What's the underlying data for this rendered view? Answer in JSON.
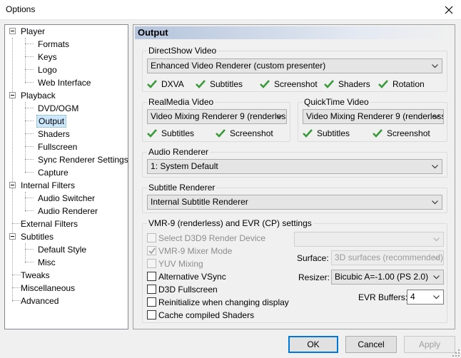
{
  "window": {
    "title": "Options"
  },
  "tree": {
    "player": "Player",
    "formats": "Formats",
    "keys": "Keys",
    "logo": "Logo",
    "web_interface": "Web Interface",
    "playback": "Playback",
    "dvd_ogm": "DVD/OGM",
    "output": "Output",
    "shaders": "Shaders",
    "fullscreen": "Fullscreen",
    "sync_renderer": "Sync Renderer Settings",
    "capture": "Capture",
    "internal_filters": "Internal Filters",
    "audio_switcher": "Audio Switcher",
    "audio_renderer": "Audio Renderer",
    "external_filters": "External Filters",
    "subtitles": "Subtitles",
    "default_style": "Default Style",
    "misc": "Misc",
    "tweaks": "Tweaks",
    "miscellaneous": "Miscellaneous",
    "advanced": "Advanced"
  },
  "page": {
    "heading": "Output"
  },
  "directshow": {
    "label": "DirectShow Video",
    "renderer": "Enhanced Video Renderer (custom presenter)",
    "features": [
      "DXVA",
      "Subtitles",
      "Screenshot",
      "Shaders",
      "Rotation"
    ]
  },
  "realmedia": {
    "label": "RealMedia Video",
    "renderer": "Video Mixing Renderer 9 (renderless",
    "features": [
      "Subtitles",
      "Screenshot"
    ]
  },
  "quicktime": {
    "label": "QuickTime Video",
    "renderer": "Video Mixing Renderer 9 (renderless",
    "features": [
      "Subtitles",
      "Screenshot"
    ]
  },
  "audio": {
    "label": "Audio Renderer",
    "value": "1: System Default"
  },
  "subtitle": {
    "label": "Subtitle Renderer",
    "value": "Internal Subtitle Renderer"
  },
  "vmr": {
    "label": "VMR-9 (renderless) and EVR (CP) settings",
    "options": {
      "select_d3d9": "Select D3D9 Render Device",
      "mixer_mode": "VMR-9 Mixer Mode",
      "yuv_mixing": "YUV Mixing",
      "alt_vsync": "Alternative VSync",
      "d3d_fullscreen": "D3D Fullscreen",
      "reinit": "Reinitialize when changing display",
      "cache_shaders": "Cache compiled Shaders"
    },
    "device_value": "",
    "surface_label": "Surface:",
    "surface_value": "3D surfaces (recommended)",
    "resizer_label": "Resizer:",
    "resizer_value": "Bicubic A=-1.00 (PS 2.0)",
    "evr_label": "EVR Buffers:",
    "evr_value": "4"
  },
  "buttons": {
    "ok": "OK",
    "cancel": "Cancel",
    "apply": "Apply"
  },
  "colors": {
    "check_green": "#3a9a3a",
    "selection": "#cce8ff",
    "default_border": "#0078d7"
  }
}
